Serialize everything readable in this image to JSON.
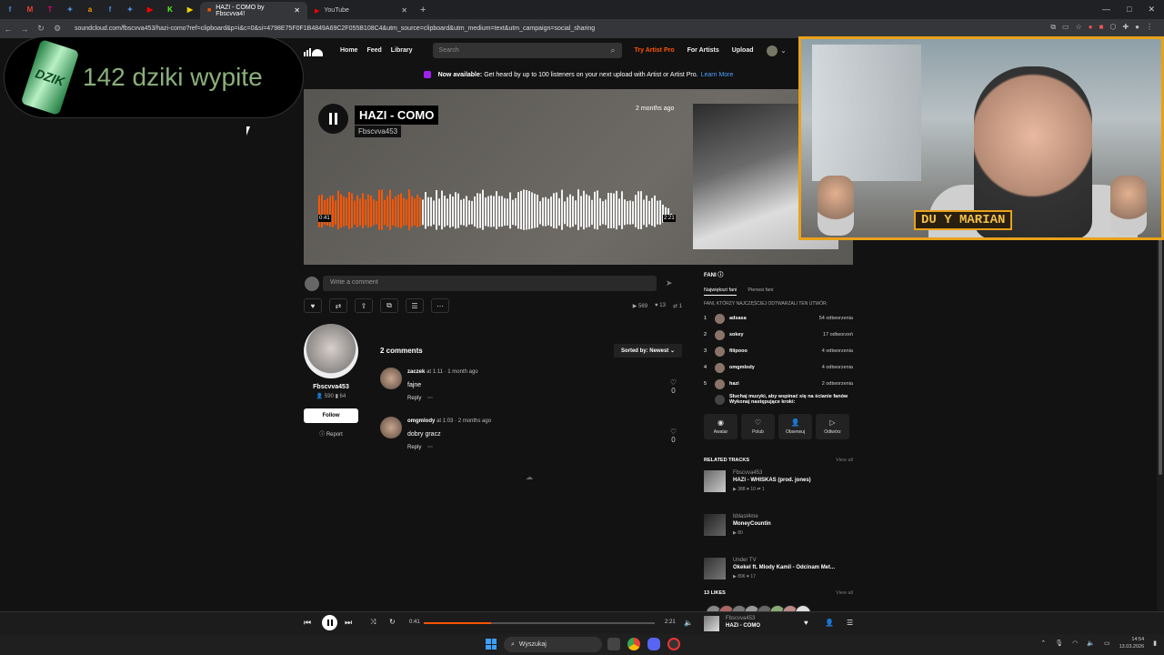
{
  "browser": {
    "tab_icons": [
      "f",
      "M",
      "T",
      "✦",
      "a",
      "f",
      "✦",
      "▶",
      "K",
      "▶"
    ],
    "tabs": [
      {
        "title": "HAZI - COMO by Fbscvva4!",
        "active": true
      },
      {
        "title": "YouTube",
        "active": false
      }
    ],
    "new_tab": "+",
    "url": "soundcloud.com/fbscvva453/hazi-como?ref=clipboard&p=i&c=0&si=4798E75F0F1B4849A69C2F055B108C4&utm_source=clipboard&utm_medium=text&utm_campaign=social_sharing"
  },
  "overlay": {
    "counter_text": "142  dziki wypite",
    "can_label": "DZIK"
  },
  "nav": {
    "home": "Home",
    "feed": "Feed",
    "library": "Library",
    "search_placeholder": "Search",
    "try_pro": "Try Artist Pro",
    "for_artists": "For Artists",
    "upload": "Upload"
  },
  "banner": {
    "bold": "Now available:",
    "text": "Get heard by up to 100 listeners on your next upload with Artist or Artist Pro.",
    "link": "Learn More"
  },
  "track": {
    "title": "HAZI - COMO",
    "artist": "Fbscvva453",
    "posted": "2 months ago",
    "time_current": "0:41",
    "time_total": "2:21",
    "progress": 0.29
  },
  "webcam": {
    "label": "DU  Y MARIAN"
  },
  "comment_input": {
    "placeholder": "Write a comment"
  },
  "stats": {
    "plays": "569",
    "likes": "13",
    "reposts": "1"
  },
  "uploader": {
    "name": "Fbscvva453",
    "followers": "590",
    "tracks": "64",
    "follow": "Follow",
    "report": "Report"
  },
  "comments": {
    "count_label": "2 comments",
    "sort_label": "Sorted by: Newest",
    "items": [
      {
        "user": "zaczek",
        "at": "at 1:11",
        "ago": "· 1 month ago",
        "text": "fajne",
        "reply": "Reply",
        "likes": "0"
      },
      {
        "user": "omgmlody",
        "at": "at 1:03",
        "ago": "· 2 months ago",
        "text": "dobry gracz",
        "reply": "Reply",
        "likes": "0"
      }
    ]
  },
  "fans": {
    "heading": "FANI",
    "tab_top": "Największi fani",
    "tab_first": "Pierwsi fani",
    "subheading": "FANI, KTÓRZY NAJCZĘŚCIEJ ODTWARZALI TEN UTWÓR:",
    "list": [
      {
        "rank": "1",
        "name": "adsasa",
        "plays": "54 odtworzenia"
      },
      {
        "rank": "2",
        "name": "sokey",
        "plays": "17 odtworzeń"
      },
      {
        "rank": "3",
        "name": "filipooo",
        "plays": "4 odtworzenia"
      },
      {
        "rank": "4",
        "name": "omgmlody",
        "plays": "4 odtworzenia"
      },
      {
        "rank": "5",
        "name": "hazi",
        "plays": "2 odtworzenia"
      }
    ],
    "promo": "Słuchaj muzyki, aby wspinać się na ścianie fanów",
    "promo2": "Wykonaj następujące kroki:",
    "buttons": [
      "Awatar",
      "Polub",
      "Obserwuj",
      "Odtwórz"
    ]
  },
  "related": {
    "heading": "RELATED TRACKS",
    "view_all": "View all",
    "tracks": [
      {
        "artist": "Fbscvva453",
        "title": "HAZI - WHISKAS (prod. jones)",
        "stats": "▶ 388  ♥ 10  ⇄ 1"
      },
      {
        "artist": "bblast4me",
        "title": "MoneyCountin",
        "stats": "▶ 80"
      },
      {
        "artist": "Under TV",
        "title": "Okekel ft. Mlody Kamil - Odcinam Met...",
        "stats": "▶ 896  ♥ 17"
      }
    ]
  },
  "likes": {
    "heading": "13 LIKES",
    "view_all": "View all"
  },
  "player": {
    "artist": "Fbscvva453",
    "title": "HAZI - COMO",
    "time_current": "0:41",
    "time_total": "2:21",
    "progress": 0.29
  },
  "taskbar": {
    "search": "Wyszukaj",
    "time": "14:54",
    "date": "13.03.2026"
  }
}
